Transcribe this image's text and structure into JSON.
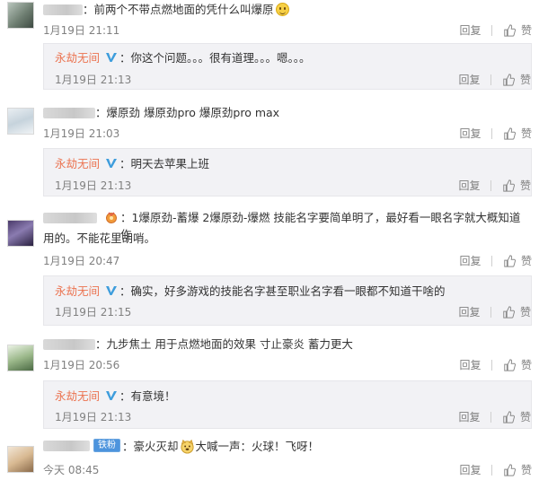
{
  "labels": {
    "reply": "回复",
    "like": "赞"
  },
  "colors": {
    "reply_name": "#eb7350",
    "verified_badge": "#3e9ddc",
    "bg": "#ffffff",
    "reply_bg": "#f2f2f5"
  },
  "icons": [
    "thumbs-up-icon",
    "verified-v-icon",
    "smile-emoji-icon",
    "medal-icon",
    "dog-emoji-icon"
  ],
  "comments": [
    {
      "text": "：前两个不带点燃地面的凭什么叫爆原",
      "time": "1月19日 21:11",
      "reply": {
        "name": "永劫无间",
        "sep": "：",
        "text": "你这个问题。。。很有道理。。。嗯。。。",
        "time": "1月19日 21:13"
      }
    },
    {
      "text": "：爆原劲 爆原劲pro 爆原劲pro max",
      "time": "1月19日 21:03",
      "reply": {
        "name": "永劫无间",
        "sep": "：",
        "text": "明天去苹果上班",
        "time": "1月19日 21:13"
      }
    },
    {
      "text": "：1爆原劲-蓄爆 2爆原劲-爆燃 技能名字要简单明了，最好看一眼名字就大概知道作",
      "text2": "用的。不能花里胡哨。",
      "time": "1月19日 20:47",
      "reply": {
        "name": "永劫无间",
        "sep": "：",
        "text": "确实，好多游戏的技能名字甚至职业名字看一眼都不知道干啥的",
        "time": "1月19日 21:15"
      }
    },
    {
      "text": "：九步焦土   用于点燃地面的效果  寸止豪炎  蓄力更大",
      "time": "1月19日 20:56",
      "reply": {
        "name": "永劫无间",
        "sep": "：",
        "text": "有意境！",
        "time": "1月19日 21:13"
      }
    },
    {
      "badge": "铁粉",
      "text_a": "：豪火灭却",
      "text_b": "大喊一声：火球！飞呀！",
      "time": "今天 08:45"
    }
  ]
}
